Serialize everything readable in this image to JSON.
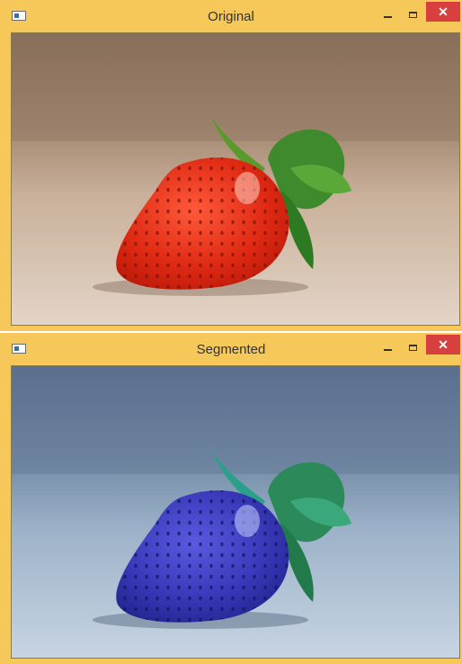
{
  "windows": [
    {
      "title": "Original",
      "icon": "opencv-window-icon",
      "controls": {
        "minimize": "minimize-icon",
        "maximize": "maximize-icon",
        "close": "close-icon"
      },
      "image": "strawberry photo on wooden table (original colors)"
    },
    {
      "title": "Segmented",
      "icon": "opencv-window-icon",
      "controls": {
        "minimize": "minimize-icon",
        "maximize": "maximize-icon",
        "close": "close-icon"
      },
      "image": "strawberry photo with color channels swapped (blue strawberry)"
    }
  ],
  "colors": {
    "title_bar": "#f5c859",
    "close_button": "#d84040",
    "original_fruit": "#e02a14",
    "segmented_fruit": "#3838b8"
  }
}
